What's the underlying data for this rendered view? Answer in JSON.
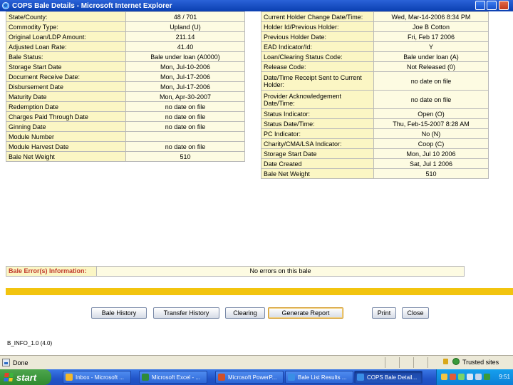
{
  "window": {
    "title": "COPS Bale Details - Microsoft Internet Explorer"
  },
  "left_table": [
    {
      "label": "State/County:",
      "value": "48 / 701"
    },
    {
      "label": "Commodity Type:",
      "value": "Upland (U)"
    },
    {
      "label": "Original Loan/LDP Amount:",
      "value": "211.14"
    },
    {
      "label": "Adjusted Loan Rate:",
      "value": "41.40"
    },
    {
      "label": "Bale Status:",
      "value": "Bale under loan (A0000)"
    },
    {
      "label": "Storage Start Date",
      "value": "Mon, Jul-10-2006"
    },
    {
      "label": "Document Receive Date:",
      "value": "Mon, Jul-17-2006"
    },
    {
      "label": "Disbursement Date",
      "value": "Mon, Jul-17-2006"
    },
    {
      "label": "Maturity Date",
      "value": "Mon, Apr-30-2007"
    },
    {
      "label": "Redemption Date",
      "value": "no date on file"
    },
    {
      "label": "Charges Paid Through Date",
      "value": "no date on file"
    },
    {
      "label": "Ginning Date",
      "value": "no date on file"
    },
    {
      "label": "Module Number",
      "value": ""
    },
    {
      "label": "Module Harvest Date",
      "value": "no date on file"
    },
    {
      "label": "Bale Net Weight",
      "value": "510"
    }
  ],
  "right_table": [
    {
      "label": "Current Holder Change Date/Time:",
      "value": "Wed, Mar-14-2006 8:34 PM",
      "tall": false
    },
    {
      "label": "Holder Id/Previous Holder:",
      "value": "Joe B Cotton",
      "tall": false
    },
    {
      "label": "Previous Holder Date:",
      "value": "Fri, Feb 17 2006",
      "tall": false
    },
    {
      "label": "EAD Indicator/Id:",
      "value": "Y",
      "tall": false
    },
    {
      "label": "Loan/Clearing Status Code:",
      "value": "Bale under loan (A)",
      "tall": false
    },
    {
      "label": "Release Code:",
      "value": "Not Released (0)",
      "tall": false
    },
    {
      "label": "Date/Time Receipt Sent to Current Holder:",
      "value": "no date on file",
      "tall": true
    },
    {
      "label": "Provider Acknowledgement Date/Time:",
      "value": "no date on file",
      "tall": true
    },
    {
      "label": "Status Indicator:",
      "value": "Open (O)",
      "tall": false
    },
    {
      "label": "Status Date/Time:",
      "value": "Thu, Feb-15-2007 8:28 AM",
      "tall": false
    },
    {
      "label": "PC Indicator:",
      "value": "No (N)",
      "tall": false
    },
    {
      "label": "Charity/CMA/LSA Indicator:",
      "value": "Coop (C)",
      "tall": false
    },
    {
      "label": "Storage Start Date",
      "value": "Mon, Jul 10 2006",
      "tall": false
    },
    {
      "label": "Date Created",
      "value": "Sat, Jul 1 2006",
      "tall": false
    },
    {
      "label": "Bale Net Weight",
      "value": "510",
      "tall": false
    }
  ],
  "errors": {
    "label": "Bale Error(s) Information:",
    "value": "No errors on this bale"
  },
  "buttons": {
    "bale_history": "Bale History",
    "transfer_history": "Transfer History",
    "clearing": "Clearing",
    "generate_report": "Generate Report",
    "print": "Print",
    "close": "Close"
  },
  "footer_code": "B_INFO_1.0 (4.0)",
  "status_bar": {
    "status": "Done",
    "zone": "Trusted sites"
  },
  "taskbar": {
    "start_label": "start",
    "tasks": [
      {
        "label": "Inbox - Microsoft ...",
        "icon_color": "#f2b82b",
        "active": false
      },
      {
        "label": "Microsoft Excel - ...",
        "icon_color": "#2e8b3a",
        "active": false
      },
      {
        "label": "Microsoft PowerP...",
        "icon_color": "#d0502a",
        "active": false
      },
      {
        "label": "Bale List Results ...",
        "icon_color": "#3a8ee6",
        "active": false
      },
      {
        "label": "COPS Bale Detail...",
        "icon_color": "#3a8ee6",
        "active": true
      }
    ],
    "clock": "9:51"
  },
  "colors": {
    "label_bg": "#fbf6c4",
    "value_bg": "#fdfbe2",
    "accent_band": "#f2c40f",
    "error_label": "#c0392b"
  }
}
